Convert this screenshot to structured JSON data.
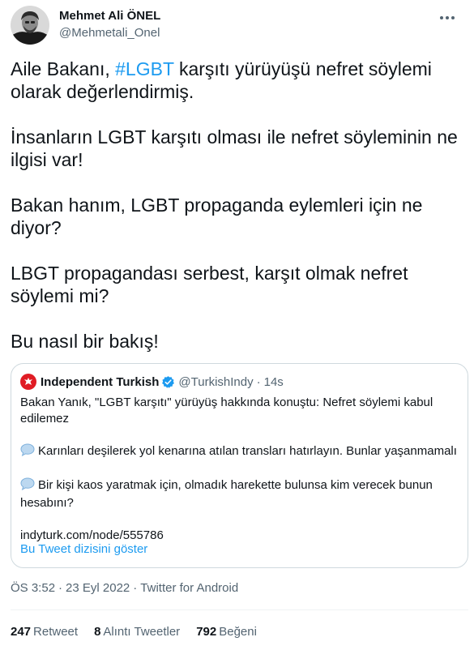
{
  "author": {
    "name": "Mehmet Ali ÖNEL",
    "handle": "@Mehmetali_Onel"
  },
  "tweet": {
    "p1_before": "Aile Bakanı, ",
    "p1_hashtag": "#LGBT",
    "p1_after": " karşıtı yürüyüşü nefret söylemi olarak değerlendirmiş.",
    "p2": "İnsanların LGBT karşıtı olması ile nefret söyleminin ne ilgisi var!",
    "p3": "Bakan hanım, LGBT propaganda eylemleri için ne diyor?",
    "p4": "LBGT propagandası serbest, karşıt olmak nefret söylemi mi?",
    "p5": "Bu nasıl bir bakış!"
  },
  "quote": {
    "name": "Independent Turkish",
    "handle": "@TurkishIndy",
    "time": "14s",
    "line1": "Bakan Yanık, \"LGBT karşıtı\" yürüyüş hakkında konuştu: Nefret söylemi kabul edilemez",
    "line2": "Karınları deşilerek yol kenarına atılan transları hatırlayın. Bunlar yaşanmamalı",
    "line3": "Bir kişi kaos yaratmak için, olmadık harekette bulunsa kim verecek bunun hesabını?",
    "link": "indyturk.com/node/555786",
    "show_thread": "Bu Tweet dizisini göster"
  },
  "meta": {
    "time": "ÖS 3:52",
    "date": "23 Eyl 2022",
    "source": "Twitter for Android"
  },
  "stats": {
    "retweets_count": "247",
    "retweets_label": "Retweet",
    "quotes_count": "8",
    "quotes_label": "Alıntı Tweetler",
    "likes_count": "792",
    "likes_label": "Beğeni"
  },
  "icons": {
    "more": "more-horizontal-icon",
    "verified": "verified-badge-icon",
    "speech": "speech-balloon-icon",
    "publisher_logo": "independent-eagle-logo"
  },
  "colors": {
    "accent": "#1d9bf0",
    "text": "#0f1419",
    "secondary": "#536471",
    "border": "#cfd9de",
    "logo_red": "#e01c24"
  }
}
